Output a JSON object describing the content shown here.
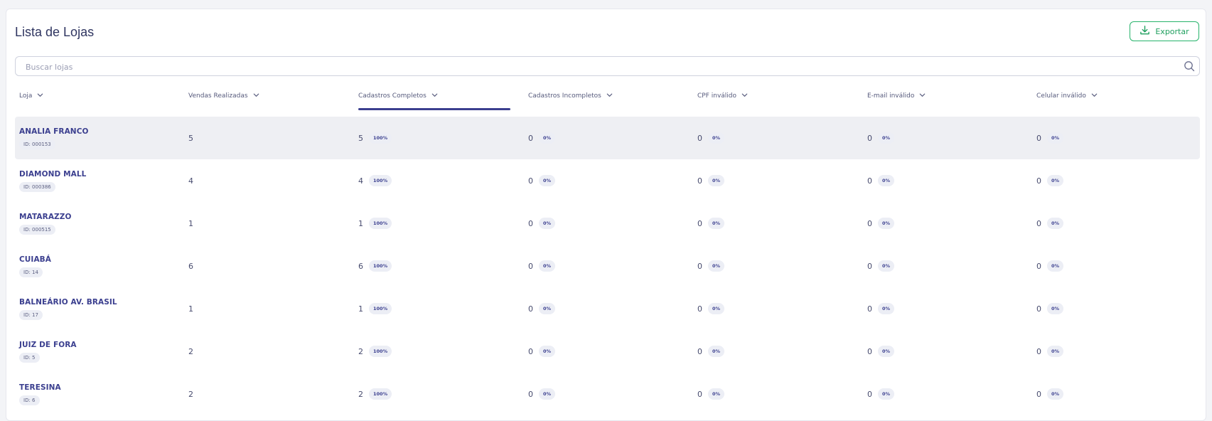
{
  "page": {
    "title": "Lista de Lojas",
    "export_label": "Exportar",
    "search_placeholder": "Buscar lojas"
  },
  "columns": [
    {
      "label": "Loja",
      "active": false
    },
    {
      "label": "Vendas Realizadas",
      "active": false
    },
    {
      "label": "Cadastros Completos",
      "active": true
    },
    {
      "label": "Cadastros Incompletos",
      "active": false
    },
    {
      "label": "CPF inválido",
      "active": false
    },
    {
      "label": "E-mail inválido",
      "active": false
    },
    {
      "label": "Celular inválido",
      "active": false
    }
  ],
  "rows": [
    {
      "name": "ANALIA FRANCO",
      "id": "ID: 000153",
      "vendas": "5",
      "completos": "5",
      "completos_pct": "100%",
      "incompletos": "0",
      "incompletos_pct": "0%",
      "cpf": "0",
      "cpf_pct": "0%",
      "email": "0",
      "email_pct": "0%",
      "celular": "0",
      "celular_pct": "0%",
      "highlighted": true
    },
    {
      "name": "DIAMOND MALL",
      "id": "ID: 000386",
      "vendas": "4",
      "completos": "4",
      "completos_pct": "100%",
      "incompletos": "0",
      "incompletos_pct": "0%",
      "cpf": "0",
      "cpf_pct": "0%",
      "email": "0",
      "email_pct": "0%",
      "celular": "0",
      "celular_pct": "0%"
    },
    {
      "name": "MATARAZZO",
      "id": "ID: 000515",
      "vendas": "1",
      "completos": "1",
      "completos_pct": "100%",
      "incompletos": "0",
      "incompletos_pct": "0%",
      "cpf": "0",
      "cpf_pct": "0%",
      "email": "0",
      "email_pct": "0%",
      "celular": "0",
      "celular_pct": "0%"
    },
    {
      "name": "CUIABÁ",
      "id": "ID: 14",
      "vendas": "6",
      "completos": "6",
      "completos_pct": "100%",
      "incompletos": "0",
      "incompletos_pct": "0%",
      "cpf": "0",
      "cpf_pct": "0%",
      "email": "0",
      "email_pct": "0%",
      "celular": "0",
      "celular_pct": "0%"
    },
    {
      "name": "BALNEÁRIO AV. BRASIL",
      "id": "ID: 17",
      "vendas": "1",
      "completos": "1",
      "completos_pct": "100%",
      "incompletos": "0",
      "incompletos_pct": "0%",
      "cpf": "0",
      "cpf_pct": "0%",
      "email": "0",
      "email_pct": "0%",
      "celular": "0",
      "celular_pct": "0%"
    },
    {
      "name": "JUIZ DE FORA",
      "id": "ID: 5",
      "vendas": "2",
      "completos": "2",
      "completos_pct": "100%",
      "incompletos": "0",
      "incompletos_pct": "0%",
      "cpf": "0",
      "cpf_pct": "0%",
      "email": "0",
      "email_pct": "0%",
      "celular": "0",
      "celular_pct": "0%"
    },
    {
      "name": "TERESINA",
      "id": "ID: 6",
      "vendas": "2",
      "completos": "2",
      "completos_pct": "100%",
      "incompletos": "0",
      "incompletos_pct": "0%",
      "cpf": "0",
      "cpf_pct": "0%",
      "email": "0",
      "email_pct": "0%",
      "celular": "0",
      "celular_pct": "0%"
    }
  ],
  "colors": {
    "accent": "#3b3f8f",
    "export_green": "#27b36b",
    "highlight_row": "#eeeff3"
  },
  "icons": {
    "export": "download-icon",
    "search": "search-icon",
    "sort": "chevron-down-icon"
  }
}
